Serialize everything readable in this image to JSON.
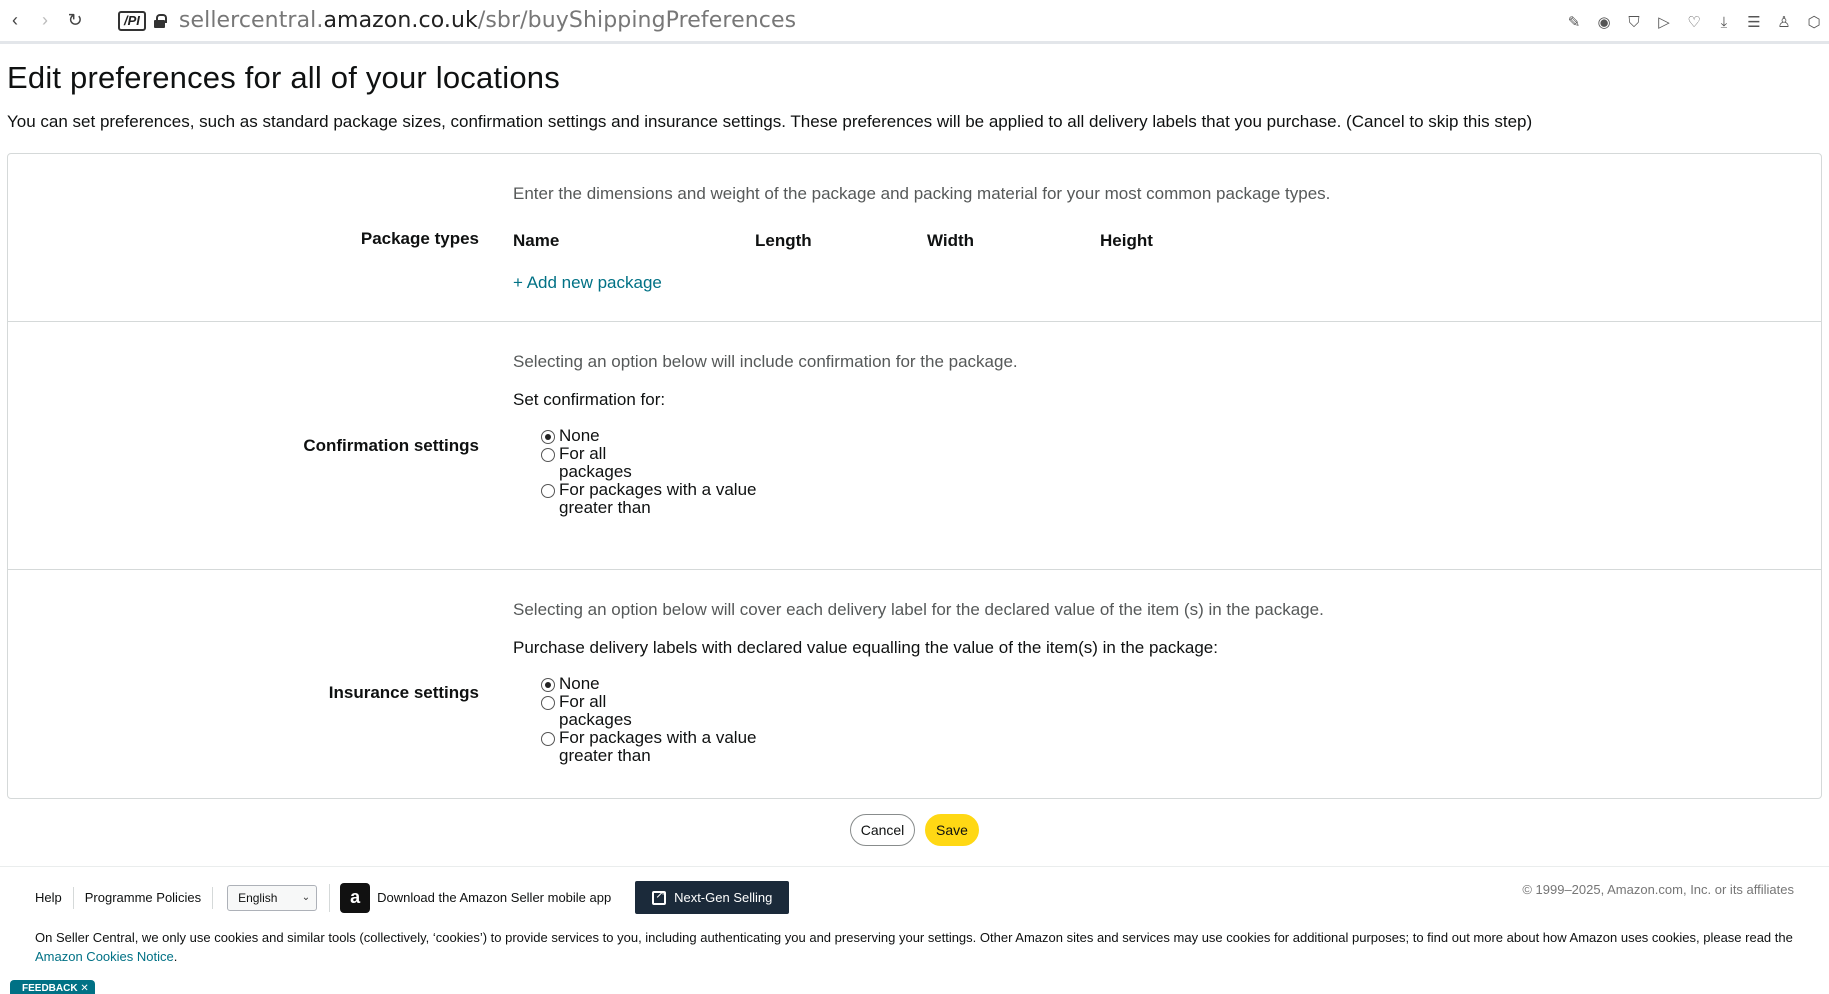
{
  "browser": {
    "pi_badge": "/PI",
    "url_domain_prefix": "sellercentral.",
    "url_domain": "amazon.co.uk",
    "url_path": "/sbr/buyShippingPreferences",
    "nav_icons": [
      "back-arrow-icon",
      "forward-arrow-icon",
      "reload-icon"
    ],
    "toolbar_icons": [
      "edit-icon",
      "camera-icon",
      "shield-icon",
      "play-icon",
      "heart-icon",
      "download-icon",
      "menu-icon",
      "profile-icon",
      "cube-icon"
    ]
  },
  "page": {
    "title": "Edit preferences for all of your locations",
    "description": "You can set preferences, such as standard package sizes, confirmation settings and insurance settings. These preferences will be applied to all delivery labels that you purchase. (Cancel to skip this step)"
  },
  "package_types": {
    "label": "Package types",
    "hint": "Enter the dimensions and weight of the package and packing material for your most common package types.",
    "columns": [
      "Name",
      "Length",
      "Width",
      "Height"
    ],
    "add_link": "+ Add new package"
  },
  "confirmation": {
    "label": "Confirmation settings",
    "hint": "Selecting an option below will include confirmation for the package.",
    "subhead": "Set confirmation for:",
    "options": [
      {
        "text": "None",
        "checked": true
      },
      {
        "text": "For all packages",
        "checked": false
      },
      {
        "text": "For packages with a value greater than",
        "checked": false
      }
    ]
  },
  "insurance": {
    "label": "Insurance settings",
    "hint": "Selecting an option below will cover each delivery label for the declared value of the item (s) in the package.",
    "subhead": "Purchase delivery labels with declared value equalling the value of the item(s) in the package:",
    "options": [
      {
        "text": "None",
        "checked": true
      },
      {
        "text": "For all packages",
        "checked": false
      },
      {
        "text": "For packages with a value greater than",
        "checked": false
      }
    ]
  },
  "actions": {
    "cancel": "Cancel",
    "save": "Save",
    "save_color": "#ffd814"
  },
  "footer": {
    "help": "Help",
    "policies": "Programme Policies",
    "language": "English",
    "app_icon_letter": "a",
    "app_download": "Download the Amazon Seller mobile app",
    "next_gen": "Next-Gen Selling",
    "copyright": "© 1999–2025, Amazon.com, Inc. or its affiliates",
    "cookie_text": "On Seller Central, we only use cookies and similar tools (collectively, ‘cookies’) to provide services to you, including authenticating you and preserving your settings. Other Amazon sites and services may use cookies for additional purposes; to find out more about how Amazon uses cookies, please read the",
    "cookie_link": "Amazon Cookies Notice",
    "cookie_end": ".",
    "feedback": "FEEDBACK ✕"
  }
}
